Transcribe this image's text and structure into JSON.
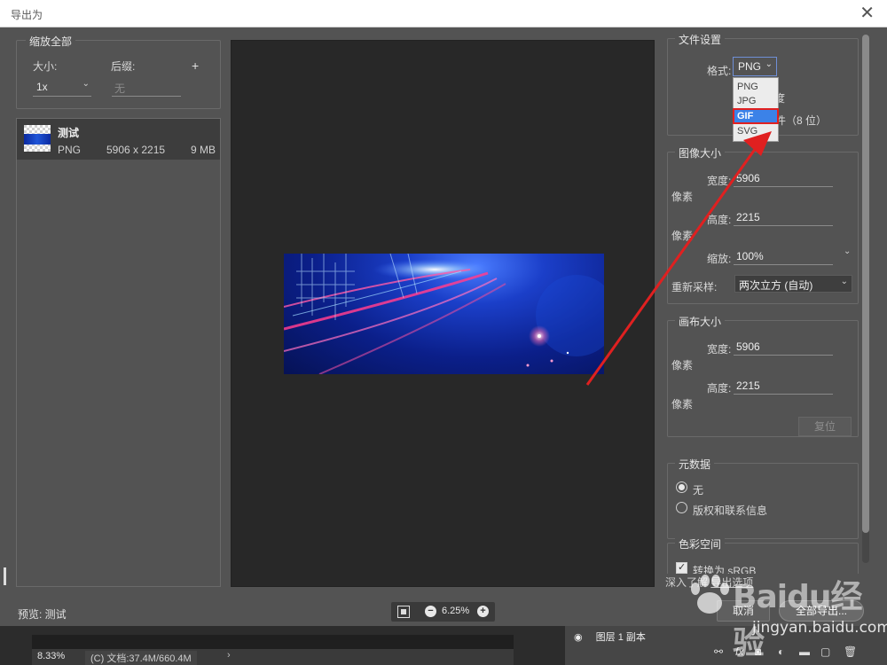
{
  "window": {
    "title": "导出为"
  },
  "left": {
    "scale_group": {
      "legend": "缩放全部",
      "size_label": "大小:",
      "suffix_label": "后缀:",
      "add": "+",
      "size_value": "1x",
      "suffix_placeholder": "无"
    },
    "asset": {
      "name": "测试",
      "format": "PNG",
      "dimensions": "5906 x 2215",
      "filesize": "9 MB"
    }
  },
  "preview": {
    "label": "预览: 测试",
    "zoom_value": "6.25%"
  },
  "file_settings": {
    "legend": "文件设置",
    "format_label": "格式:",
    "format_value": "PNG",
    "options": [
      "PNG",
      "JPG",
      "GIF",
      "SVG"
    ],
    "highlighted_option": "GIF",
    "partial_1": "度",
    "partial_2": "件（8 位）"
  },
  "image_size": {
    "legend": "图像大小",
    "width_label": "宽度:",
    "width_value": "5906",
    "height_label": "高度:",
    "height_value": "2215",
    "unit": "像素",
    "scale_label": "缩放:",
    "scale_value": "100%",
    "resample_label": "重新采样:",
    "resample_value": "两次立方 (自动)"
  },
  "canvas_size": {
    "legend": "画布大小",
    "width_label": "宽度:",
    "width_value": "5906",
    "height_label": "高度:",
    "height_value": "2215",
    "unit": "像素",
    "reset": "复位"
  },
  "metadata": {
    "legend": "元数据",
    "option_none": "无",
    "option_copyright": "版权和联系信息"
  },
  "color_space": {
    "legend": "色彩空间",
    "convert_srgb": "转换为 sRGB"
  },
  "footer": {
    "learn_more": "深入了解",
    "export_options_link": "导出选项",
    "cancel": "取消",
    "export_all": "全部导出..."
  },
  "app": {
    "status_zoom": "8.33%",
    "status_doc": "(C) 文档:37.4M/660.4M",
    "layer_text": "图层 1 副本"
  },
  "watermark": {
    "brand": "Baidu经验",
    "url": "jingyan.baidu.com"
  },
  "colors": {
    "annotation_red": "#e02020",
    "highlight_blue": "#3b82e8"
  }
}
